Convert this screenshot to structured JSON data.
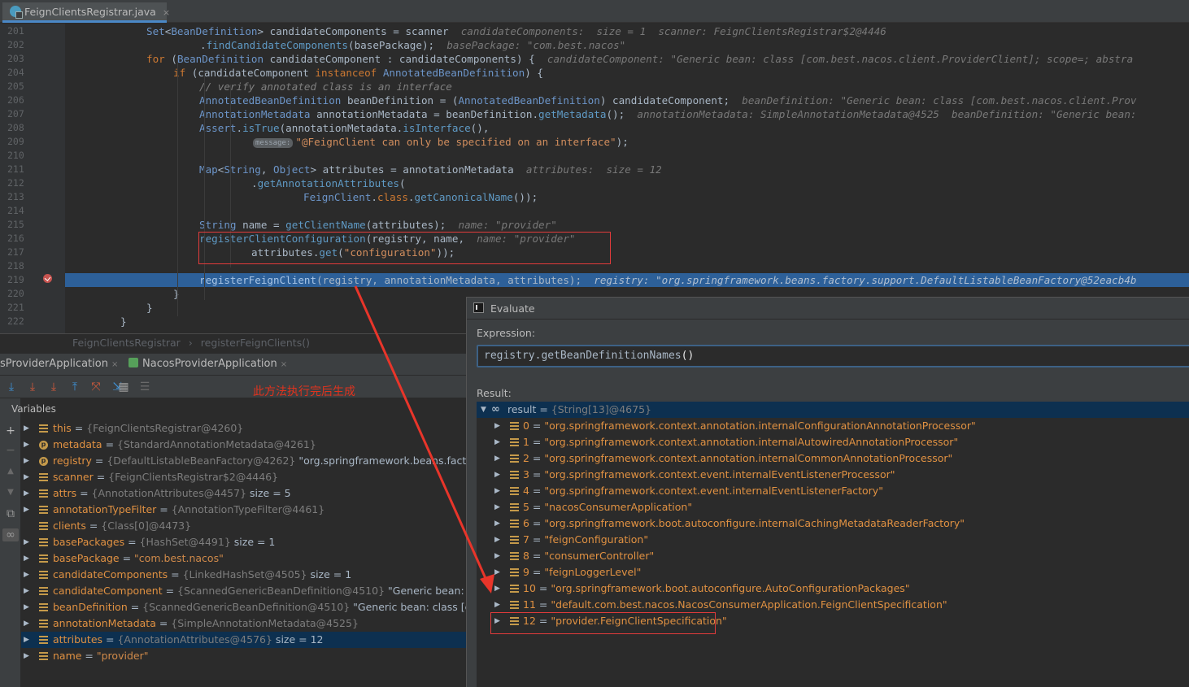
{
  "editor_tab": {
    "title": "FeignClientsRegistrar.java",
    "close": "×"
  },
  "code_lines": [
    {
      "n": "201",
      "parts": [
        [
          "",
          ""
        ],
        [
          "ty",
          "Set"
        ],
        [
          "",
          "<"
        ],
        [
          "ty",
          "BeanDefinition"
        ],
        [
          "",
          "> candidateComponents = scanner  "
        ],
        [
          "hint",
          "candidateComponents:  size = 1  scanner: FeignClientsRegistrar$2@4446"
        ]
      ],
      "indent": 100
    },
    {
      "n": "202",
      "parts": [
        [
          "",
          "."
        ],
        [
          "fn",
          "findCandidateComponents"
        ],
        [
          "",
          "(basePackage);  "
        ],
        [
          "hint",
          "basePackage: \"com.best.nacos\""
        ]
      ],
      "indent": 166
    },
    {
      "n": "203",
      "parts": [
        [
          "kw",
          "for "
        ],
        [
          "",
          "("
        ],
        [
          "ty",
          "BeanDefinition"
        ],
        [
          "",
          " candidateComponent : candidateComponents) {  "
        ],
        [
          "hint",
          "candidateComponent: \"Generic bean: class [com.best.nacos.client.ProviderClient]; scope=; abstra"
        ]
      ],
      "indent": 100
    },
    {
      "n": "204",
      "parts": [
        [
          "kw",
          "if "
        ],
        [
          "",
          "(candidateComponent "
        ],
        [
          "kw",
          "instanceof "
        ],
        [
          "ty",
          "AnnotatedBeanDefinition"
        ],
        [
          "",
          ") {"
        ]
      ],
      "indent": 133
    },
    {
      "n": "205",
      "parts": [
        [
          "cm",
          "// verify annotated class is an interface"
        ]
      ],
      "indent": 165
    },
    {
      "n": "206",
      "parts": [
        [
          "ty",
          "AnnotatedBeanDefinition"
        ],
        [
          "",
          " beanDefinition = ("
        ],
        [
          "ty",
          "AnnotatedBeanDefinition"
        ],
        [
          "",
          ") candidateComponent;  "
        ],
        [
          "hint",
          "beanDefinition: \"Generic bean: class [com.best.nacos.client.Prov"
        ]
      ],
      "indent": 165
    },
    {
      "n": "207",
      "parts": [
        [
          "ty",
          "AnnotationMetadata"
        ],
        [
          "",
          " annotationMetadata = beanDefinition."
        ],
        [
          "fn",
          "getMetadata"
        ],
        [
          "",
          "();  "
        ],
        [
          "hint",
          "annotationMetadata: SimpleAnnotationMetadata@4525  beanDefinition: \"Generic bean:"
        ]
      ],
      "indent": 165
    },
    {
      "n": "208",
      "parts": [
        [
          "ty",
          "Assert"
        ],
        [
          "",
          "."
        ],
        [
          "fn",
          "isTrue"
        ],
        [
          "",
          "(annotationMetadata."
        ],
        [
          "fn",
          "isInterface"
        ],
        [
          "",
          "(),"
        ]
      ],
      "indent": 165
    },
    {
      "n": "209",
      "parts": [
        [
          "pill",
          "message:"
        ],
        [
          "st",
          "\"@FeignClient can only be specified on an interface\""
        ],
        [
          "",
          ");"
        ]
      ],
      "indent": 231
    },
    {
      "n": "210",
      "parts": [],
      "indent": 165
    },
    {
      "n": "211",
      "parts": [
        [
          "ty",
          "Map"
        ],
        [
          "",
          "<"
        ],
        [
          "ty",
          "String"
        ],
        [
          "",
          ", "
        ],
        [
          "ty",
          "Object"
        ],
        [
          "",
          "> attributes = annotationMetadata  "
        ],
        [
          "hint",
          "attributes:  size = 12"
        ]
      ],
      "indent": 165
    },
    {
      "n": "212",
      "parts": [
        [
          "",
          "."
        ],
        [
          "fn",
          "getAnnotationAttributes"
        ],
        [
          "",
          "("
        ]
      ],
      "indent": 229
    },
    {
      "n": "213",
      "parts": [
        [
          "ty",
          "FeignClient"
        ],
        [
          "",
          "."
        ],
        [
          "kw",
          "class"
        ],
        [
          "",
          "."
        ],
        [
          "fn",
          "getCanonicalName"
        ],
        [
          "",
          "());"
        ]
      ],
      "indent": 293
    },
    {
      "n": "214",
      "parts": [],
      "indent": 165
    },
    {
      "n": "215",
      "parts": [
        [
          "ty",
          "String"
        ],
        [
          "",
          " name = "
        ],
        [
          "fn",
          "getClientName"
        ],
        [
          "",
          "(attributes);  "
        ],
        [
          "hint",
          "name: \"provider\""
        ]
      ],
      "indent": 165
    },
    {
      "n": "216",
      "parts": [
        [
          "fn",
          "registerClientConfiguration"
        ],
        [
          "",
          "(registry, name,  "
        ],
        [
          "hint",
          "name: \"provider\""
        ]
      ],
      "indent": 165
    },
    {
      "n": "217",
      "parts": [
        [
          "",
          "attributes."
        ],
        [
          "fn",
          "get"
        ],
        [
          "",
          "("
        ],
        [
          "st",
          "\"configuration\""
        ],
        [
          "",
          "));"
        ]
      ],
      "indent": 229
    },
    {
      "n": "218",
      "parts": [],
      "indent": 165
    },
    {
      "n": "219",
      "parts": [
        [
          "fn",
          "registerFeignClient"
        ],
        [
          "",
          "(registry, annotationMetadata, attributes);  "
        ],
        [
          "hint-on",
          "registry: \"org.springframework.beans.factory.support.DefaultListableBeanFactory@52eacb4b"
        ]
      ],
      "indent": 165,
      "current": true
    },
    {
      "n": "220",
      "parts": [
        [
          "",
          "}"
        ]
      ],
      "indent": 133
    },
    {
      "n": "221",
      "parts": [
        [
          "",
          "}"
        ]
      ],
      "indent": 100
    },
    {
      "n": "222",
      "parts": [
        [
          "",
          "}"
        ]
      ],
      "indent": 68
    }
  ],
  "breadcrumb": {
    "a": "FeignClientsRegistrar",
    "sep": "›",
    "b": "registerFeignClients()"
  },
  "debug_tabs": [
    {
      "label": "sProviderApplication",
      "close": "×"
    },
    {
      "label": "NacosProviderApplication",
      "close": "×"
    }
  ],
  "annotation_note": "此方法执行完后生成",
  "variables_title": "Variables",
  "variables": [
    {
      "icon": "field",
      "name": "this",
      "val": "{FeignClientsRegistrar@4260}",
      "tail": ""
    },
    {
      "icon": "p",
      "name": "metadata",
      "val": "{StandardAnnotationMetadata@4261}",
      "tail": ""
    },
    {
      "icon": "p",
      "name": "registry",
      "val": "{DefaultListableBeanFactory@4262}",
      "tail": " \"org.springframework.beans.factory.supp"
    },
    {
      "icon": "field",
      "name": "scanner",
      "val": "{FeignClientsRegistrar$2@4446}",
      "tail": ""
    },
    {
      "icon": "field",
      "name": "attrs",
      "val": "{AnnotationAttributes@4457}",
      "tail": "  size = 5"
    },
    {
      "icon": "field",
      "name": "annotationTypeFilter",
      "val": "{AnnotationTypeFilter@4461}",
      "tail": ""
    },
    {
      "icon": "field",
      "name": "clients",
      "val": "{Class[0]@4473}",
      "tail": "",
      "noexpand": true
    },
    {
      "icon": "field",
      "name": "basePackages",
      "val": "{HashSet@4491}",
      "tail": "  size = 1"
    },
    {
      "icon": "field",
      "name": "basePackage",
      "val": "",
      "str": "\"com.best.nacos\"",
      "tail": ""
    },
    {
      "icon": "field",
      "name": "candidateComponents",
      "val": "{LinkedHashSet@4505}",
      "tail": "  size = 1"
    },
    {
      "icon": "field",
      "name": "candidateComponent",
      "val": "{ScannedGenericBeanDefinition@4510}",
      "tail": " \"Generic bean: class [cc"
    },
    {
      "icon": "field",
      "name": "beanDefinition",
      "val": "{ScannedGenericBeanDefinition@4510}",
      "tail": " \"Generic bean: class [com.best"
    },
    {
      "icon": "field",
      "name": "annotationMetadata",
      "val": "{SimpleAnnotationMetadata@4525}",
      "tail": ""
    },
    {
      "icon": "field",
      "name": "attributes",
      "val": "{AnnotationAttributes@4576}",
      "tail": "  size = 12",
      "selected": true
    },
    {
      "icon": "field",
      "name": "name",
      "val": "",
      "str": "\"provider\"",
      "tail": ""
    }
  ],
  "evaluate": {
    "title": "Evaluate",
    "expression_label": "Expression:",
    "expression": "registry.getBeanDefinitionNames",
    "expression_parens": "()",
    "result_label": "Result:",
    "root": {
      "name": "result",
      "val": "{String[13]@4675}"
    },
    "items": [
      "\"org.springframework.context.annotation.internalConfigurationAnnotationProcessor\"",
      "\"org.springframework.context.annotation.internalAutowiredAnnotationProcessor\"",
      "\"org.springframework.context.annotation.internalCommonAnnotationProcessor\"",
      "\"org.springframework.context.event.internalEventListenerProcessor\"",
      "\"org.springframework.context.event.internalEventListenerFactory\"",
      "\"nacosConsumerApplication\"",
      "\"org.springframework.boot.autoconfigure.internalCachingMetadataReaderFactory\"",
      "\"feignConfiguration\"",
      "\"consumerController\"",
      "\"feignLoggerLevel\"",
      "\"org.springframework.boot.autoconfigure.AutoConfigurationPackages\"",
      "\"default.com.best.nacos.NacosConsumerApplication.FeignClientSpecification\"",
      "\"provider.FeignClientSpecification\""
    ]
  },
  "colors": {
    "highlight_box": "#e23b3b",
    "arrow": "#e8352a",
    "current_line": "#2d6099"
  }
}
